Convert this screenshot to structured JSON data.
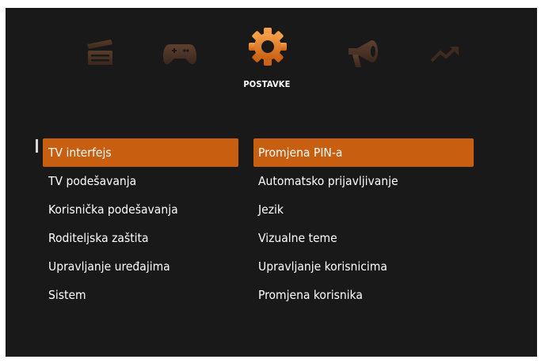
{
  "colors": {
    "background": "#191919",
    "accent": "#c75e10",
    "icon_inactive": "#4a3326",
    "text": "#ffffff"
  },
  "top_nav": {
    "items": [
      {
        "icon": "clapperboard-icon",
        "active": false
      },
      {
        "icon": "gamepad-icon",
        "active": false
      },
      {
        "icon": "gear-icon",
        "active": true
      },
      {
        "icon": "megaphone-icon",
        "active": false
      },
      {
        "icon": "trend-up-icon",
        "active": false
      }
    ],
    "active_label": "POSTAVKE"
  },
  "left_menu": {
    "items": [
      {
        "label": "TV interfejs",
        "selected": true
      },
      {
        "label": "TV podešavanja",
        "selected": false
      },
      {
        "label": "Korisnička podešavanja",
        "selected": false
      },
      {
        "label": "Roditeljska zaštita",
        "selected": false
      },
      {
        "label": "Upravljanje uređajima",
        "selected": false
      },
      {
        "label": "Sistem",
        "selected": false
      }
    ]
  },
  "right_menu": {
    "items": [
      {
        "label": "Promjena PIN-a",
        "selected": true
      },
      {
        "label": "Automatsko prijavljivanje",
        "selected": false
      },
      {
        "label": "Jezik",
        "selected": false
      },
      {
        "label": "Vizualne teme",
        "selected": false
      },
      {
        "label": "Upravljanje korisnicima",
        "selected": false
      },
      {
        "label": "Promjena korisnika",
        "selected": false
      }
    ]
  }
}
